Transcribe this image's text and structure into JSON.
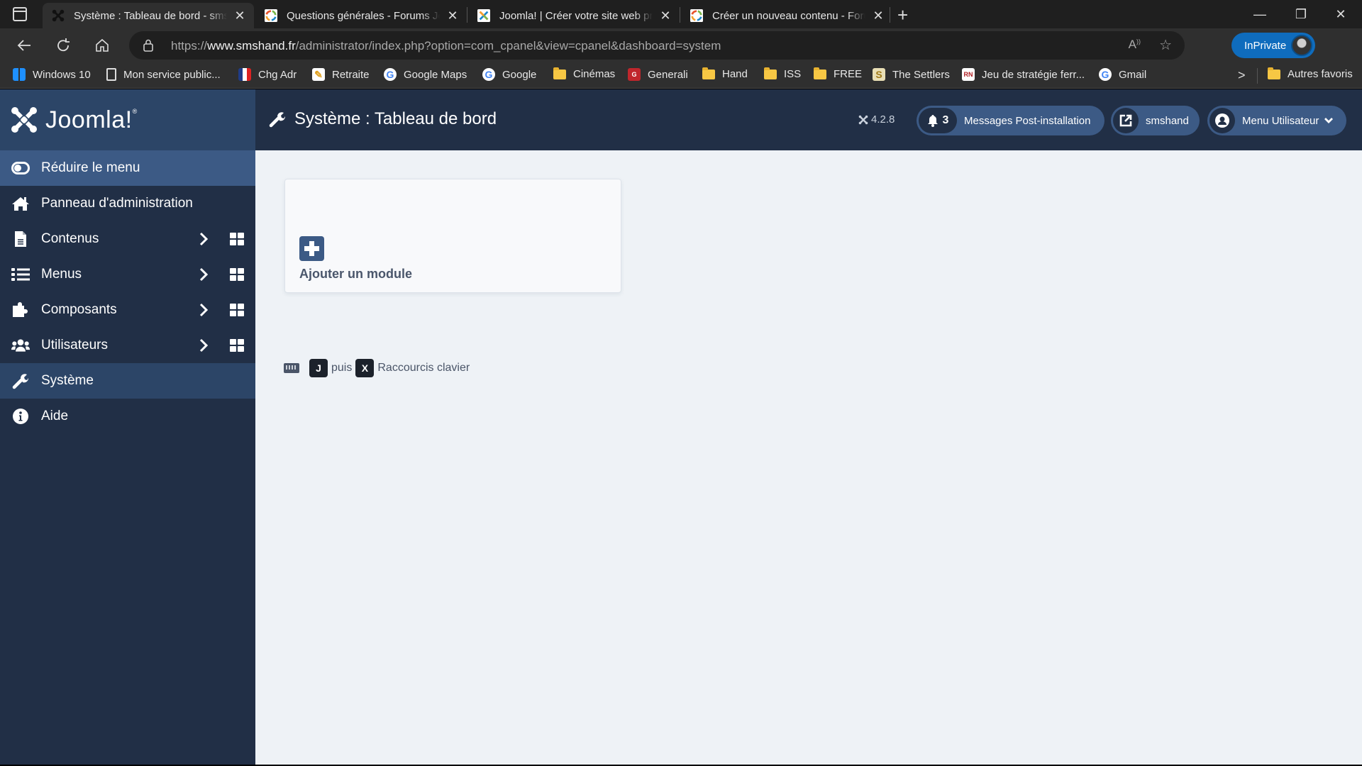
{
  "browser": {
    "tabs": [
      {
        "title": "Système : Tableau de bord - smshand",
        "icon": "joomla-icon",
        "active": true
      },
      {
        "title": "Questions générales - Forums Joomla",
        "icon": "joomla-forum-icon",
        "active": false
      },
      {
        "title": "Joomla! | Créer votre site web professionnel",
        "icon": "joomla-icon",
        "active": false
      },
      {
        "title": "Créer un nouveau contenu - Forums Joomla",
        "icon": "joomla-forum-icon",
        "active": false
      }
    ],
    "close_glyph": "✕",
    "new_tab_glyph": "+",
    "window_controls": {
      "minimize": "—",
      "restore": "❐",
      "close": "✕"
    },
    "url": {
      "scheme": "https://",
      "host": "www.smshand.fr",
      "path": "/administrator/index.php?option=com_cpanel&view=cpanel&dashboard=system"
    },
    "inprivate_label": "InPrivate",
    "more_glyph": "···",
    "bookmarks": [
      {
        "label": "Windows 10",
        "icon": "windows-icon"
      },
      {
        "label": "Mon service public...",
        "icon": "page-icon"
      },
      {
        "label": "Chg Adr",
        "icon": "flag-icon"
      },
      {
        "label": "Retraite",
        "icon": "retraite-icon"
      },
      {
        "label": "Google Maps",
        "icon": "google-icon"
      },
      {
        "label": "Google",
        "icon": "google-icon"
      },
      {
        "label": "Cinémas",
        "icon": "folder-icon"
      },
      {
        "label": "Generali",
        "icon": "generali-icon"
      },
      {
        "label": "Hand",
        "icon": "folder-icon"
      },
      {
        "label": "ISS",
        "icon": "folder-icon"
      },
      {
        "label": "FREE",
        "icon": "folder-icon"
      },
      {
        "label": "The Settlers",
        "icon": "settlers-icon"
      },
      {
        "label": "Jeu de stratégie ferr...",
        "icon": "railnation-icon"
      },
      {
        "label": "Gmail",
        "icon": "google-icon"
      }
    ],
    "other_favorites": "Autres favoris"
  },
  "joomla": {
    "brand": "Joomla!",
    "brand_reg": "®",
    "sidebar": {
      "items": [
        {
          "label": "Réduire le menu",
          "icon": "toggle-icon"
        },
        {
          "label": "Panneau d'administration",
          "icon": "home-icon"
        },
        {
          "label": "Contenus",
          "icon": "file-icon",
          "expandable": true
        },
        {
          "label": "Menus",
          "icon": "list-icon",
          "expandable": true
        },
        {
          "label": "Composants",
          "icon": "puzzle-icon",
          "expandable": true
        },
        {
          "label": "Utilisateurs",
          "icon": "users-icon",
          "expandable": true
        },
        {
          "label": "Système",
          "icon": "wrench-icon",
          "active": true
        },
        {
          "label": "Aide",
          "icon": "info-icon"
        }
      ]
    },
    "header": {
      "title": "Système : Tableau de bord",
      "version": "4.2.8",
      "notifications_count": "3",
      "post_install_label": "Messages Post-installation",
      "site_label": "smshand",
      "user_menu_label": "Menu Utilisateur"
    },
    "main": {
      "add_module_label": "Ajouter un module",
      "shortcut": {
        "key1": "J",
        "then": "puis",
        "key2": "X",
        "label": "Raccourcis clavier"
      }
    }
  }
}
